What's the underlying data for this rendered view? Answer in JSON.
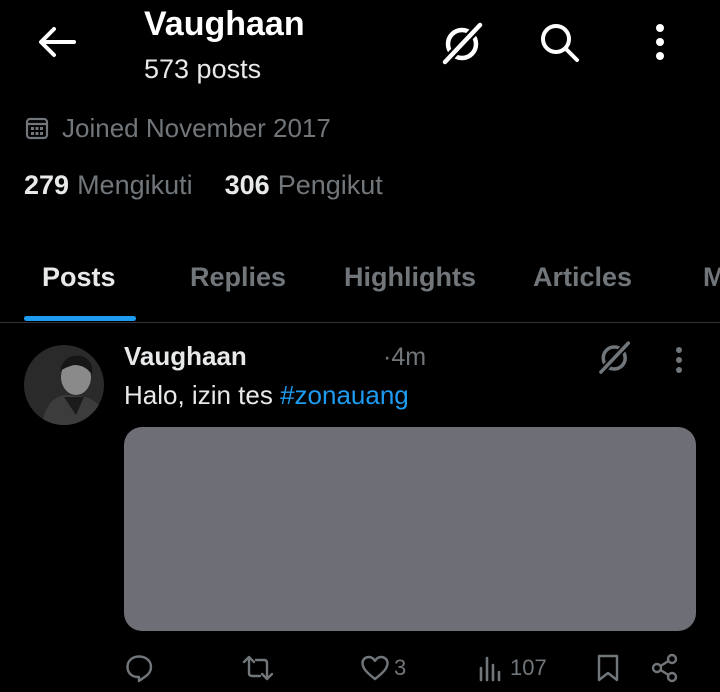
{
  "header": {
    "title": "Vaughaan",
    "post_count": "573 posts"
  },
  "profile": {
    "joined": "Joined November 2017",
    "following_count": "279",
    "following_label": "Mengikuti",
    "followers_count": "306",
    "followers_label": "Pengikut"
  },
  "tabs": [
    {
      "label": "Posts",
      "active": true
    },
    {
      "label": "Replies",
      "active": false
    },
    {
      "label": "Highlights",
      "active": false
    },
    {
      "label": "Articles",
      "active": false
    },
    {
      "label": "M",
      "active": false
    }
  ],
  "post": {
    "author": "Vaughaan",
    "time": "·4m",
    "text_prefix": "Halo, izin tes ",
    "hashtag": "#zonauang",
    "likes": "3",
    "views": "107"
  },
  "icons": {
    "back": "arrow-left-icon",
    "grok": "grok-icon",
    "search": "search-icon",
    "more": "more-vertical-icon",
    "calendar": "calendar-icon",
    "reply": "reply-icon",
    "repost": "repost-icon",
    "like": "heart-icon",
    "views": "views-icon",
    "bookmark": "bookmark-icon",
    "share": "share-icon"
  },
  "colors": {
    "background": "#000000",
    "accent": "#1d9bf0",
    "text": "#e7e9ea",
    "muted": "#71767b",
    "media_placeholder": "#6e6e76"
  }
}
